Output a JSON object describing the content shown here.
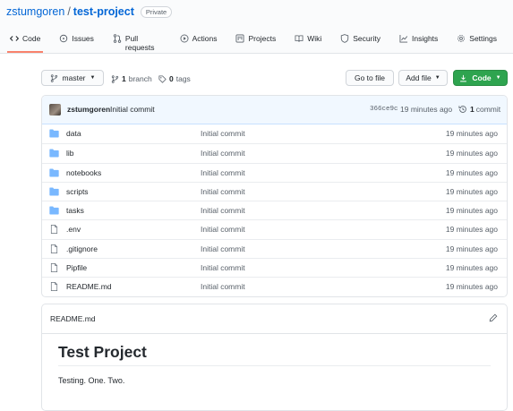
{
  "repo": {
    "owner": "zstumgoren",
    "separator": "/",
    "name": "test-project",
    "visibility": "Private"
  },
  "tabs": [
    {
      "label": "Code",
      "icon": "code-icon",
      "active": true
    },
    {
      "label": "Issues",
      "icon": "issue-icon"
    },
    {
      "label": "Pull requests",
      "icon": "pull-request-icon"
    },
    {
      "label": "Actions",
      "icon": "play-icon"
    },
    {
      "label": "Projects",
      "icon": "project-icon"
    },
    {
      "label": "Wiki",
      "icon": "book-icon"
    },
    {
      "label": "Security",
      "icon": "shield-icon"
    },
    {
      "label": "Insights",
      "icon": "graph-icon"
    },
    {
      "label": "Settings",
      "icon": "gear-icon"
    }
  ],
  "toolbar": {
    "branch_label": "master",
    "branches_count": "1",
    "branches_label": "branch",
    "tags_count": "0",
    "tags_label": "tags",
    "go_to_file": "Go to file",
    "add_file": "Add file",
    "code_button": "Code"
  },
  "latest_commit": {
    "author": "zstumgoren",
    "message": "Initial commit",
    "sha": "366ce9c",
    "age": "19 minutes ago",
    "count": "1",
    "count_label": "commit"
  },
  "files": [
    {
      "name": "data",
      "type": "dir",
      "message": "Initial commit",
      "age": "19 minutes ago"
    },
    {
      "name": "lib",
      "type": "dir",
      "message": "Initial commit",
      "age": "19 minutes ago"
    },
    {
      "name": "notebooks",
      "type": "dir",
      "message": "Initial commit",
      "age": "19 minutes ago"
    },
    {
      "name": "scripts",
      "type": "dir",
      "message": "Initial commit",
      "age": "19 minutes ago"
    },
    {
      "name": "tasks",
      "type": "dir",
      "message": "Initial commit",
      "age": "19 minutes ago"
    },
    {
      "name": ".env",
      "type": "file",
      "message": "Initial commit",
      "age": "19 minutes ago"
    },
    {
      "name": ".gitignore",
      "type": "file",
      "message": "Initial commit",
      "age": "19 minutes ago"
    },
    {
      "name": "Pipfile",
      "type": "file",
      "message": "Initial commit",
      "age": "19 minutes ago"
    },
    {
      "name": "README.md",
      "type": "file",
      "message": "Initial commit",
      "age": "19 minutes ago"
    }
  ],
  "readme": {
    "filename": "README.md",
    "heading": "Test Project",
    "body": "Testing. One. Two."
  },
  "colors": {
    "link": "#0366d6",
    "folder": "#79b8ff",
    "code_button": "#2ea44f",
    "active_tab_underline": "#f9826c"
  }
}
